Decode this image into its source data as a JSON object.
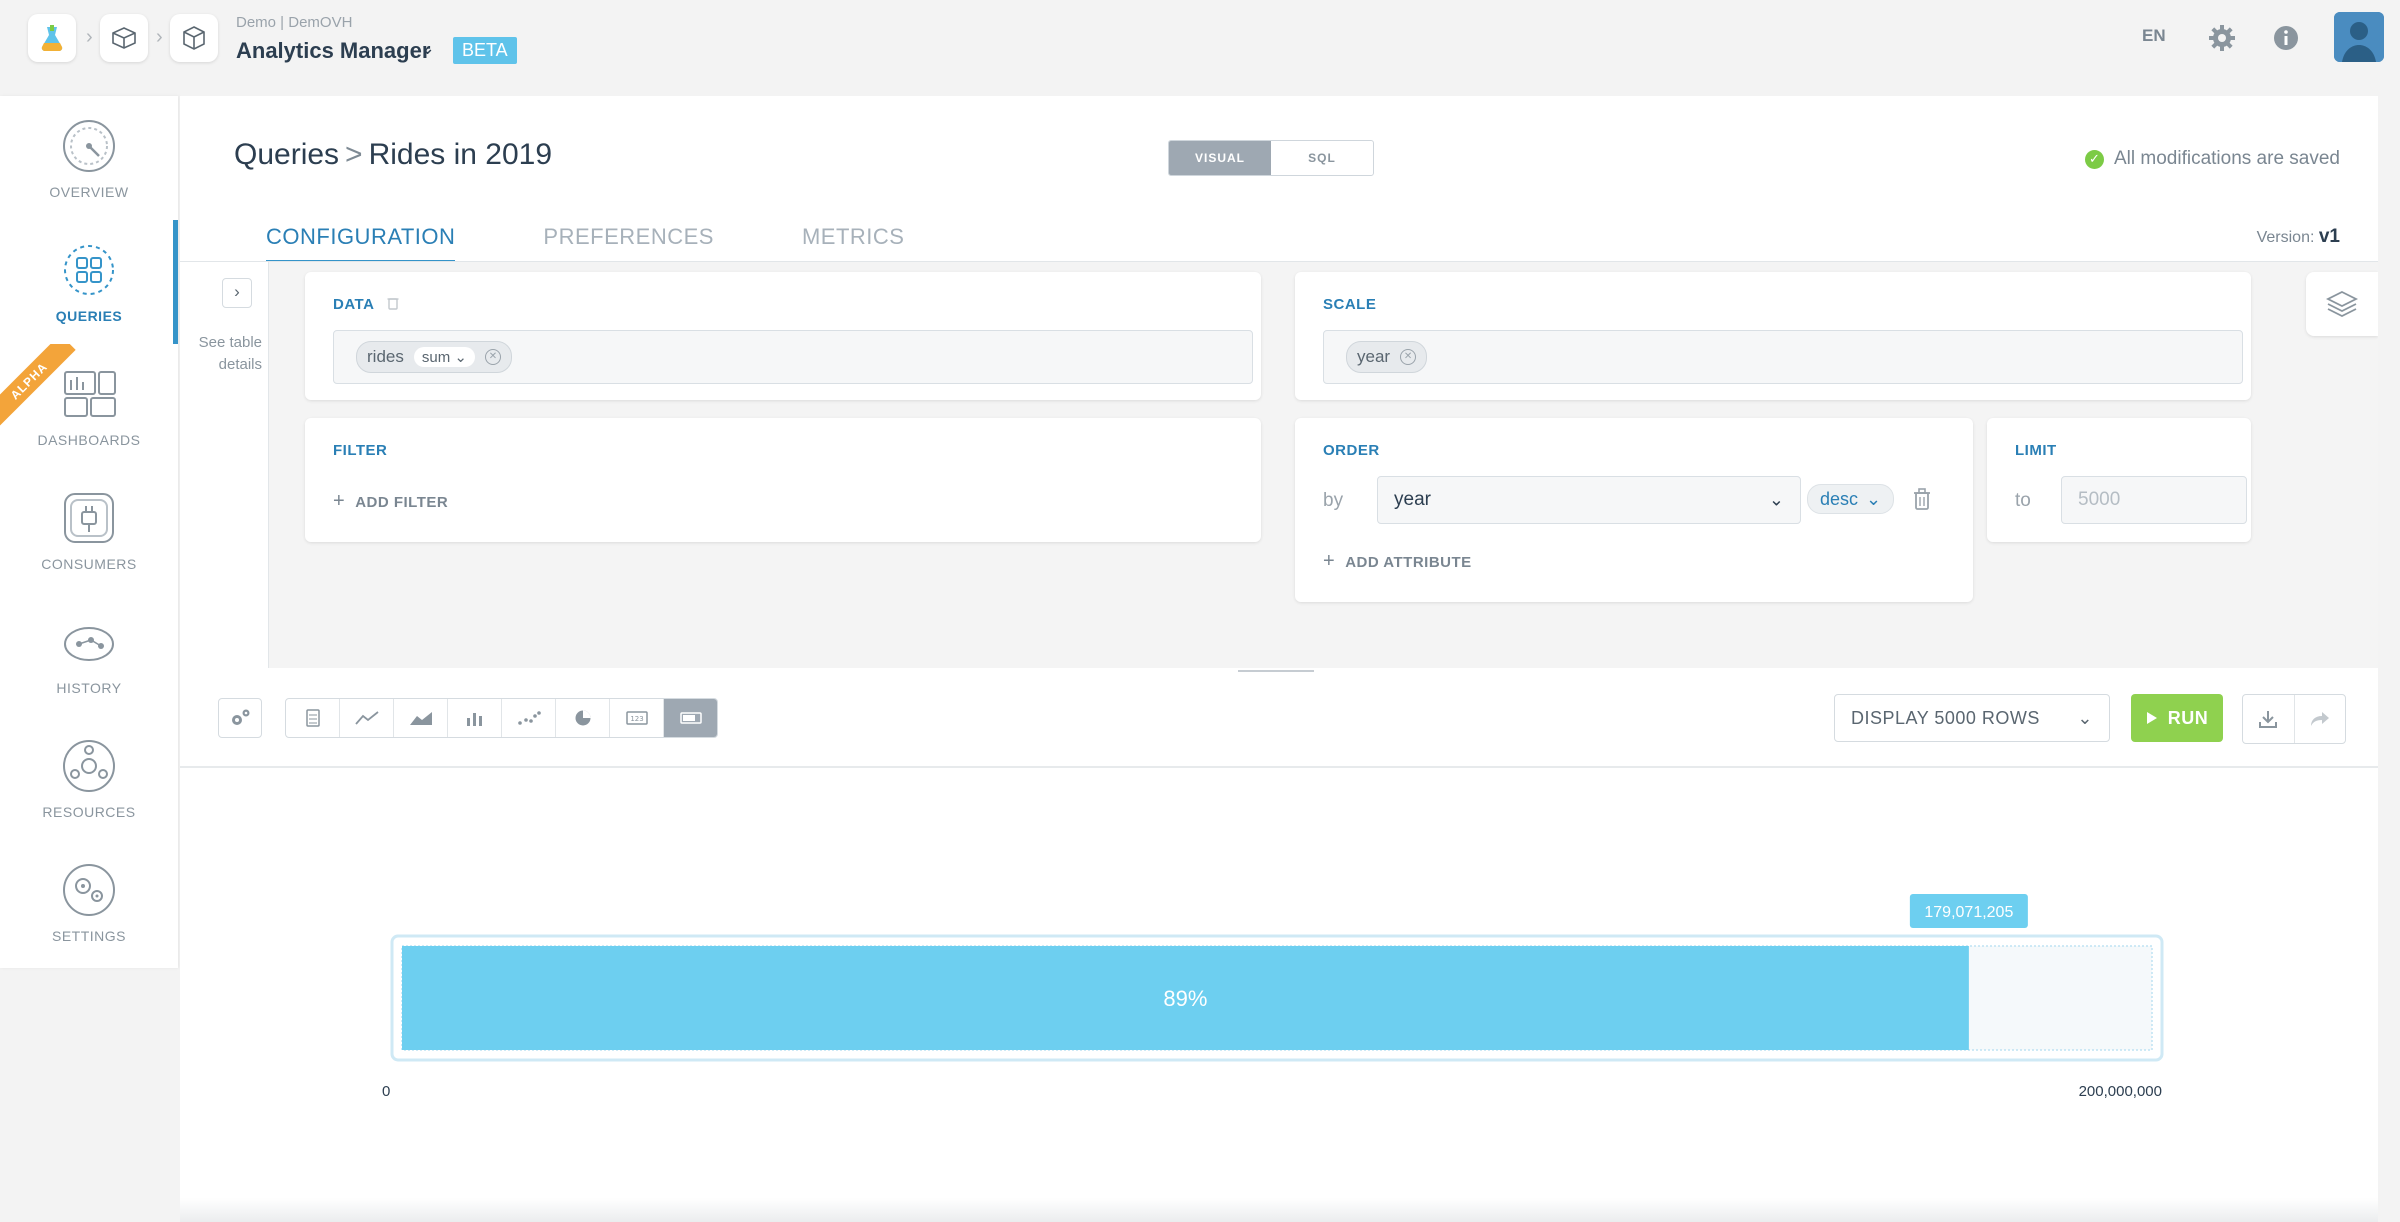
{
  "header": {
    "breadcrumb_sub": "Demo | DemOVH",
    "app_title": "Analytics Manager",
    "beta_badge": "BETA",
    "language": "EN"
  },
  "sidebar": {
    "items": [
      {
        "label": "OVERVIEW",
        "icon": "dashboard-gauge-icon"
      },
      {
        "label": "QUERIES",
        "icon": "queries-grid-icon",
        "active": true
      },
      {
        "label": "DASHBOARDS",
        "icon": "dashboards-icon",
        "ribbon": "ALPHA"
      },
      {
        "label": "CONSUMERS",
        "icon": "consumers-plug-icon"
      },
      {
        "label": "HISTORY",
        "icon": "history-icon"
      },
      {
        "label": "RESOURCES",
        "icon": "resources-icon"
      },
      {
        "label": "SETTINGS",
        "icon": "settings-icon"
      }
    ]
  },
  "page": {
    "breadcrumb_root": "Queries",
    "breadcrumb_current": "Rides in 2019",
    "mode_visual": "VISUAL",
    "mode_sql": "SQL",
    "saved_status": "All modifications are saved",
    "version_label": "Version:",
    "version_value": "v1",
    "tabs": [
      "CONFIGURATION",
      "PREFERENCES",
      "METRICS"
    ],
    "see_table_details": "See table details"
  },
  "config": {
    "data_title": "DATA",
    "data_chip_field": "rides",
    "data_chip_agg": "sum",
    "scale_title": "SCALE",
    "scale_chip": "year",
    "filter_title": "FILTER",
    "add_filter": "ADD FILTER",
    "order_title": "ORDER",
    "order_by_label": "by",
    "order_field": "year",
    "order_direction": "desc",
    "add_attribute": "ADD ATTRIBUTE",
    "limit_title": "LIMIT",
    "limit_to_label": "to",
    "limit_placeholder": "5000"
  },
  "toolbar": {
    "display_rows": "DISPLAY 5000 ROWS",
    "run_label": "RUN",
    "chart_types": [
      "table-icon",
      "line-chart-icon",
      "area-chart-icon",
      "bar-chart-icon",
      "scatter-icon",
      "pie-chart-icon",
      "number-icon",
      "gauge-bar-icon"
    ],
    "active_chart_type": "gauge-bar-icon"
  },
  "chart_data": {
    "type": "bar",
    "orientation": "horizontal-gauge",
    "value": 179071205,
    "value_label": "179,071,205",
    "percent_label": "89%",
    "min_label": "0",
    "max_label": "200,000,000",
    "range": [
      0,
      200000000
    ],
    "fill_color": "#6dcff0",
    "tooltip_color": "#6dcff0"
  }
}
